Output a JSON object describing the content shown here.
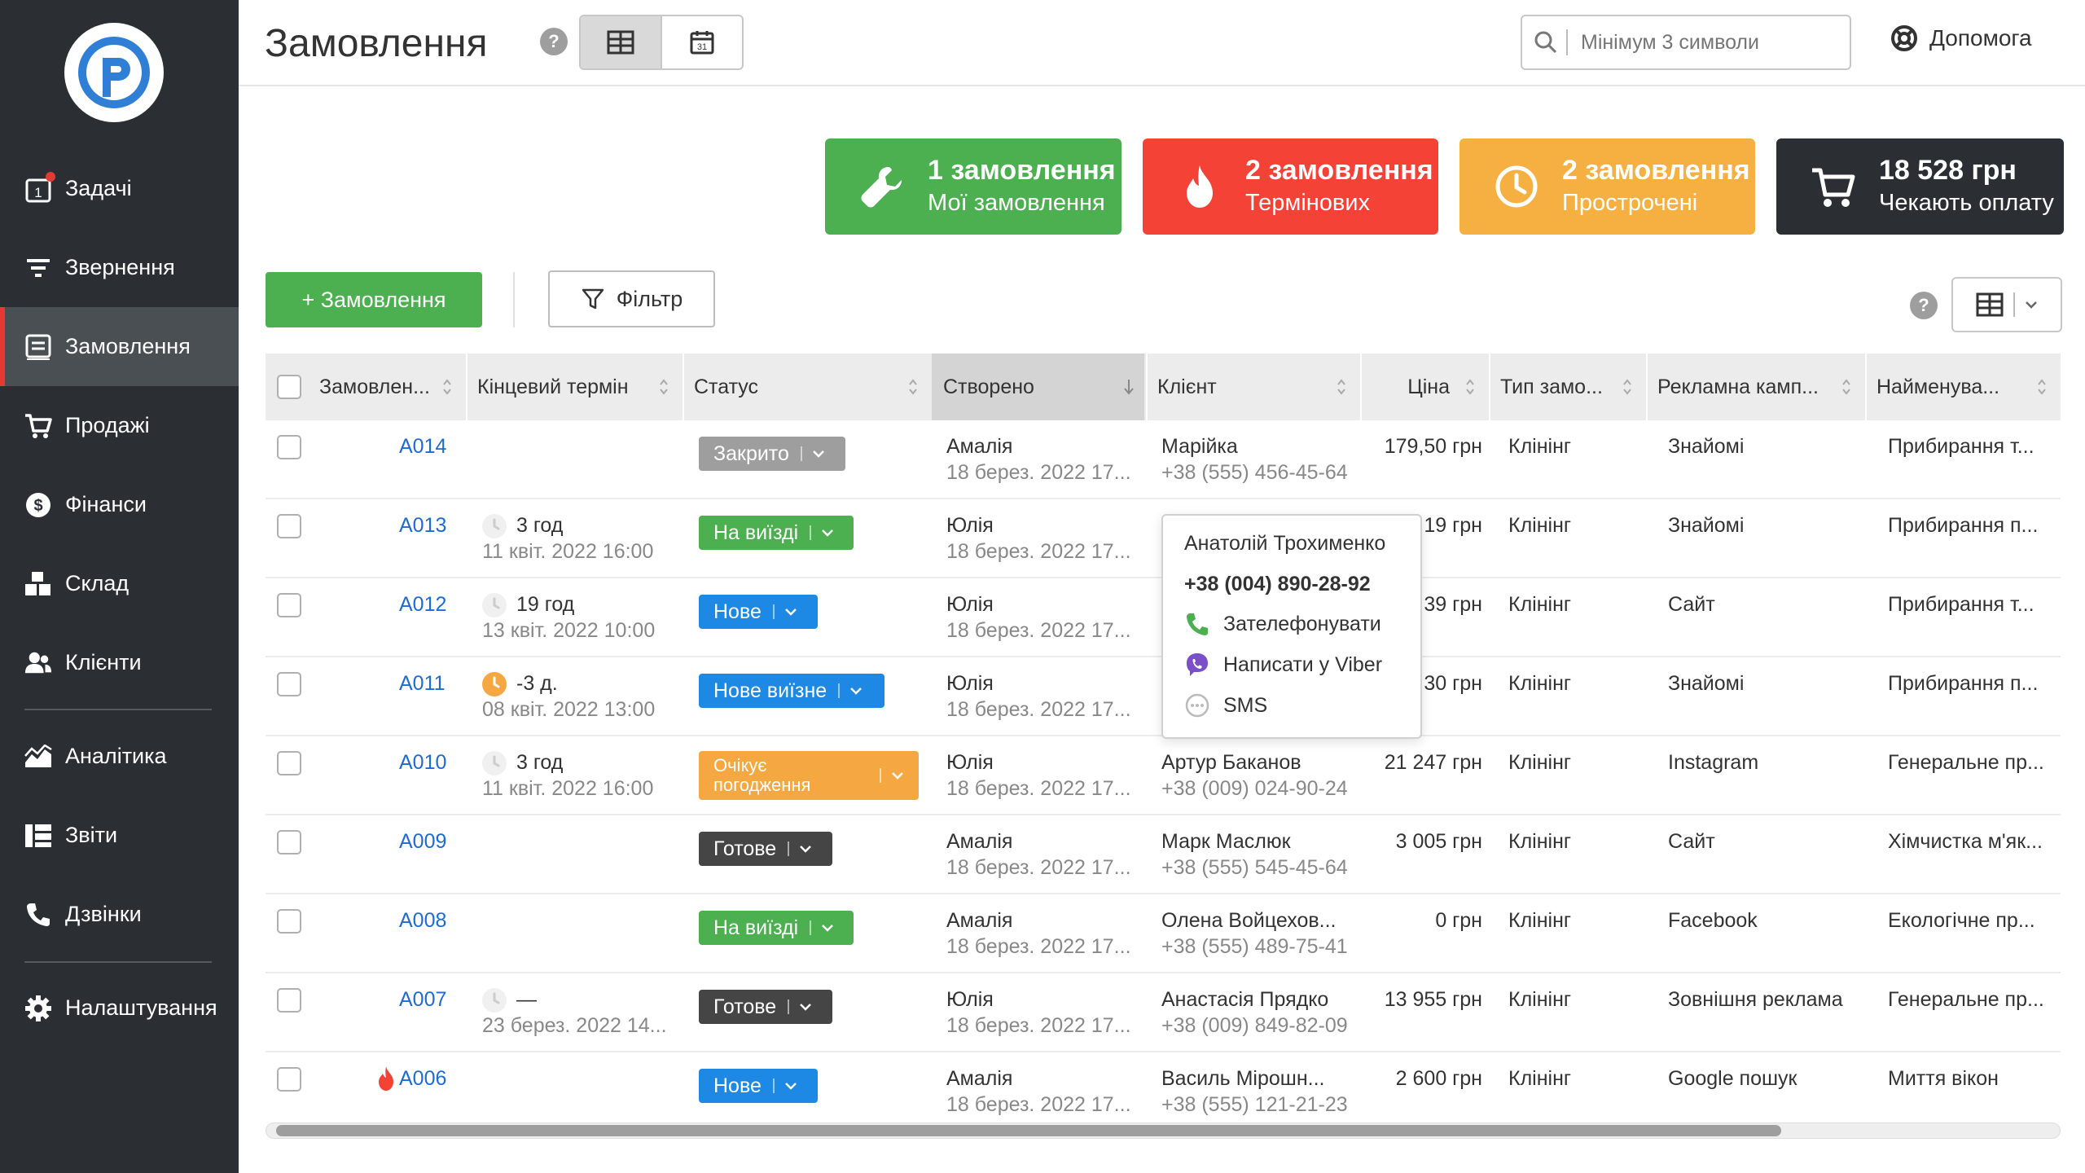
{
  "sidebar": {
    "items": [
      {
        "label": "Задачі",
        "icon": "tasks-icon",
        "badge_text": "1"
      },
      {
        "label": "Звернення",
        "icon": "requests-icon"
      },
      {
        "label": "Замовлення",
        "icon": "orders-icon",
        "active": true
      },
      {
        "label": "Продажі",
        "icon": "cart-icon"
      },
      {
        "label": "Фінанси",
        "icon": "finance-icon"
      },
      {
        "label": "Склад",
        "icon": "warehouse-icon"
      },
      {
        "label": "Клієнти",
        "icon": "clients-icon"
      },
      {
        "label": "Аналітика",
        "icon": "analytics-icon"
      },
      {
        "label": "Звіти",
        "icon": "reports-icon"
      },
      {
        "label": "Дзвінки",
        "icon": "phone-icon"
      },
      {
        "label": "Налаштування",
        "icon": "settings-icon"
      }
    ]
  },
  "header": {
    "title": "Замовлення",
    "help": "?",
    "calendar_day": "31",
    "search_placeholder": "Мінімум 3 символи",
    "help_label": "Допомога"
  },
  "kpis": [
    {
      "title": "1 замовлення",
      "subtitle": "Мої замовлення",
      "color": "#4caf50",
      "icon": "wrench-icon"
    },
    {
      "title": "2 замовлення",
      "subtitle": "Термінових",
      "color": "#f44336",
      "icon": "fire-icon"
    },
    {
      "title": "2 замовлення",
      "subtitle": "Прострочені",
      "color": "#f5b041",
      "icon": "clock-icon"
    },
    {
      "title": "18 528 грн",
      "subtitle": "Чекають оплату",
      "color": "#2b2f33",
      "icon": "cart-icon"
    }
  ],
  "toolbar": {
    "add_label": "+ Замовлення",
    "filter_label": "Фільтр",
    "help": "?"
  },
  "table": {
    "columns": [
      "Замовлен...",
      "Кінцевий термін",
      "Статус",
      "Створено",
      "Клієнт",
      "Ціна",
      "Тип замо...",
      "Рекламна камп...",
      "Найменува..."
    ],
    "sorted_column": "Створено",
    "rows": [
      {
        "id": "A014",
        "deadline": "",
        "deadline_sub": "",
        "deadline_icon": "none",
        "status": "Закрито",
        "status_color": "#9e9e9e",
        "creator": "Амалія",
        "created": "18 берез. 2022 17...",
        "client": "Марійка",
        "phone": "+38 (555) 456-45-64",
        "price": "179,50 грн",
        "type": "Клінінг",
        "campaign": "Знайомі",
        "name": "Прибирання т...",
        "urgent": false
      },
      {
        "id": "A013",
        "deadline": "3 год",
        "deadline_sub": "11 квіт. 2022 16:00",
        "deadline_icon": "grey",
        "status": "На виїзді",
        "status_color": "#4caf50",
        "creator": "Юлія",
        "created": "18 берез. 2022 17...",
        "client": "",
        "phone": "",
        "price": "19 грн",
        "type": "Клінінг",
        "campaign": "Знайомі",
        "name": "Прибирання п...",
        "urgent": false
      },
      {
        "id": "A012",
        "deadline": "19 год",
        "deadline_sub": "13 квіт. 2022 10:00",
        "deadline_icon": "grey",
        "status": "Нове",
        "status_color": "#1e88e5",
        "creator": "Юлія",
        "created": "18 берез. 2022 17...",
        "client": "",
        "phone": "",
        "price": "39 грн",
        "type": "Клінінг",
        "campaign": "Сайт",
        "name": "Прибирання т...",
        "urgent": false
      },
      {
        "id": "A011",
        "deadline": "-3 д.",
        "deadline_sub": "08 квіт. 2022 13:00",
        "deadline_icon": "orange",
        "status": "Нове виїзне",
        "status_color": "#1e88e5",
        "creator": "Юлія",
        "created": "18 берез. 2022 17...",
        "client": "",
        "phone": "",
        "price": "30 грн",
        "type": "Клінінг",
        "campaign": "Знайомі",
        "name": "Прибирання п...",
        "urgent": false
      },
      {
        "id": "A010",
        "deadline": "3 год",
        "deadline_sub": "11 квіт. 2022 16:00",
        "deadline_icon": "grey",
        "status": "Очікує погодження",
        "status_color": "#f5a742",
        "creator": "Юлія",
        "created": "18 берез. 2022 17...",
        "client": "Артур Баканов",
        "phone": "+38 (009) 024-90-24",
        "price": "21 247 грн",
        "type": "Клінінг",
        "campaign": "Instagram",
        "name": "Генеральне пр...",
        "urgent": false
      },
      {
        "id": "A009",
        "deadline": "",
        "deadline_sub": "",
        "deadline_icon": "none",
        "status": "Готове",
        "status_color": "#454545",
        "creator": "Амалія",
        "created": "18 берез. 2022 17...",
        "client": "Марк Маслюк",
        "phone": "+38 (555) 545-45-64",
        "price": "3 005 грн",
        "type": "Клінінг",
        "campaign": "Сайт",
        "name": "Хімчистка м'як...",
        "urgent": false
      },
      {
        "id": "A008",
        "deadline": "",
        "deadline_sub": "",
        "deadline_icon": "none",
        "status": "На виїзді",
        "status_color": "#4caf50",
        "creator": "Амалія",
        "created": "18 берез. 2022 17...",
        "client": "Олена Войцехов...",
        "phone": "+38 (555) 489-75-41",
        "price": "0 грн",
        "type": "Клінінг",
        "campaign": "Facebook",
        "name": "Екологічне пр...",
        "urgent": false
      },
      {
        "id": "A007",
        "deadline": "—",
        "deadline_sub": "23 берез. 2022 14...",
        "deadline_icon": "grey",
        "status": "Готове",
        "status_color": "#454545",
        "creator": "Юлія",
        "created": "18 берез. 2022 17...",
        "client": "Анастасія Прядко",
        "phone": "+38 (009) 849-82-09",
        "price": "13 955 грн",
        "type": "Клінінг",
        "campaign": "Зовнішня реклама",
        "name": "Генеральне пр...",
        "urgent": false
      },
      {
        "id": "A006",
        "deadline": "",
        "deadline_sub": "",
        "deadline_icon": "none",
        "status": "Нове",
        "status_color": "#1e88e5",
        "creator": "Амалія",
        "created": "18 берез. 2022 17...",
        "client": "Василь Мірошн...",
        "phone": "+38 (555) 121-21-23",
        "price": "2 600 грн",
        "type": "Клінінг",
        "campaign": "Google пошук",
        "name": "Миття вікон",
        "urgent": true
      }
    ]
  },
  "popover": {
    "name": "Анатолій Трохименко",
    "phone": "+38 (004) 890-28-92",
    "call_label": "Зателефонувати",
    "viber_label": "Написати у Viber",
    "sms_label": "SMS"
  }
}
